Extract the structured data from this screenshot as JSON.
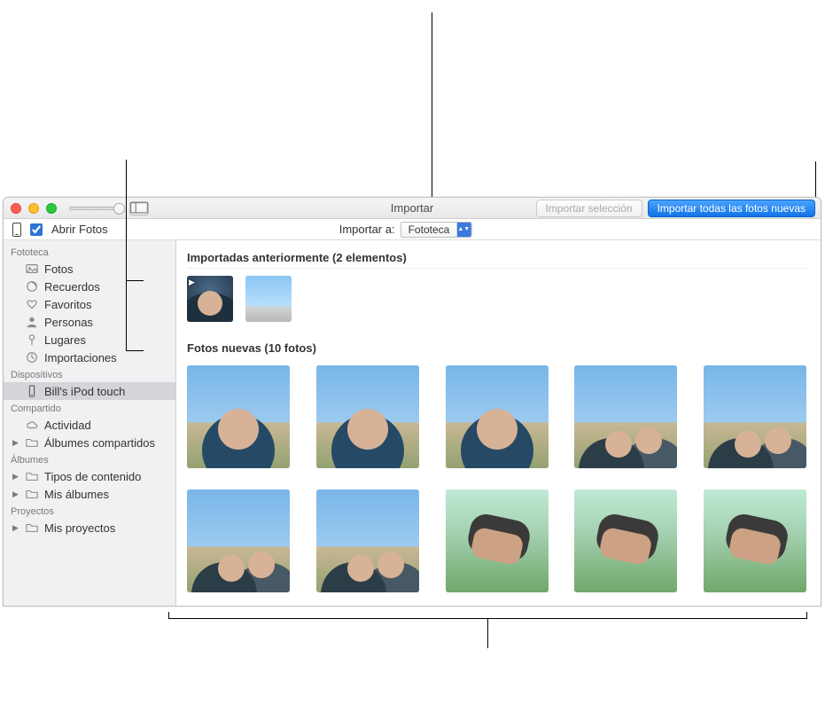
{
  "window": {
    "title": "Importar",
    "buttons": {
      "import_selection": "Importar selección",
      "import_all_new": "Importar todas las fotos nuevas"
    }
  },
  "subbar": {
    "open_photos_label": "Abrir Fotos",
    "open_photos_checked": true,
    "import_to_label": "Importar a:",
    "import_to_value": "Fototeca"
  },
  "sidebar": {
    "groups": [
      {
        "header": "Fototeca",
        "items": [
          {
            "label": "Fotos",
            "icon": "photos"
          },
          {
            "label": "Recuerdos",
            "icon": "memories"
          },
          {
            "label": "Favoritos",
            "icon": "heart"
          },
          {
            "label": "Personas",
            "icon": "person"
          },
          {
            "label": "Lugares",
            "icon": "pin"
          },
          {
            "label": "Importaciones",
            "icon": "clock"
          }
        ]
      },
      {
        "header": "Dispositivos",
        "items": [
          {
            "label": "Bill's iPod touch",
            "icon": "device",
            "selected": true
          }
        ]
      },
      {
        "header": "Compartido",
        "items": [
          {
            "label": "Actividad",
            "icon": "cloud"
          },
          {
            "label": "Álbumes compartidos",
            "icon": "folder",
            "disclosure": true
          }
        ]
      },
      {
        "header": "Álbumes",
        "items": [
          {
            "label": "Tipos de contenido",
            "icon": "folder",
            "disclosure": true
          },
          {
            "label": "Mis álbumes",
            "icon": "folder",
            "disclosure": true
          }
        ]
      },
      {
        "header": "Proyectos",
        "items": [
          {
            "label": "Mis proyectos",
            "icon": "folder",
            "disclosure": true
          }
        ]
      }
    ]
  },
  "content": {
    "already_imported": {
      "title": "Importadas anteriormente (2 elementos)",
      "count": 2,
      "items": [
        {
          "kind": "video",
          "style": "p-blue"
        },
        {
          "kind": "photo",
          "style": "p-portrait"
        }
      ]
    },
    "new_photos": {
      "title": "Fotos nuevas (10 fotos)",
      "count": 10,
      "items": [
        {
          "style": "p-selfie"
        },
        {
          "style": "p-selfie"
        },
        {
          "style": "p-selfie"
        },
        {
          "style": "p-two"
        },
        {
          "style": "p-two"
        },
        {
          "style": "p-two"
        },
        {
          "style": "p-two"
        },
        {
          "style": "p-grass"
        },
        {
          "style": "p-grass"
        },
        {
          "style": "p-grass"
        }
      ]
    }
  }
}
